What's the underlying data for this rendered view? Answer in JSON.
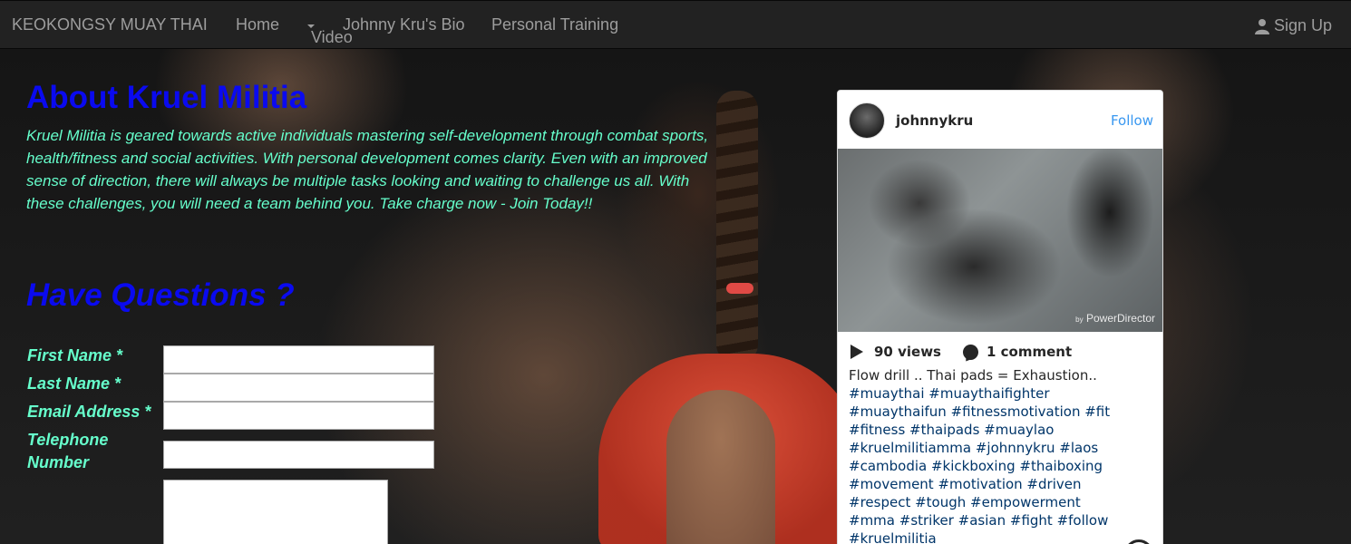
{
  "nav": {
    "brand": "KEOKONGSY MUAY THAI",
    "home": "Home",
    "video": "Video",
    "bio": "Johnny Kru's Bio",
    "personal_training": "Personal Training",
    "signup": "Sign Up"
  },
  "about": {
    "title": "About Kruel Militia",
    "text": "Kruel Militia is geared towards active individuals mastering self-development through combat sports, health/fitness and social activities. With personal development comes clarity. Even with an improved sense of direction, there will always be multiple tasks looking and waiting to challenge us all. With these challenges, you will need a team behind you. Take charge now - Join Today!!"
  },
  "form": {
    "title": "Have Questions ?",
    "first_name_label": "First Name *",
    "last_name_label": "Last Name *",
    "email_label": "Email Address *",
    "phone_label": "Telephone Number",
    "first_name_value": "",
    "last_name_value": "",
    "email_value": "",
    "phone_value": "",
    "message_value": ""
  },
  "instagram": {
    "username": "johnnykru",
    "follow": "Follow",
    "watermark_by": "by",
    "watermark_brand": "PowerDirector",
    "views": "90 views",
    "comments": "1 comment",
    "caption_text": "Flow drill .. Thai pads = Exhaustion..",
    "caption_tags": "#muaythai #muaythaifighter #muaythaifun #fitnessmotivation #fit #fitness #thaipads #muaylao #kruelmilitiamma #johnnykru #laos #cambodia #kickboxing #thaiboxing #movement #motivation #driven #respect #tough #empowerment #mma #striker #asian #fight #follow #kruelmilitia"
  },
  "colors": {
    "heading": "#0a0af0",
    "body_text": "#66ffcc",
    "navbar": "#222222",
    "nav_text": "#9d9d9d",
    "ig_link": "#3897f0"
  }
}
